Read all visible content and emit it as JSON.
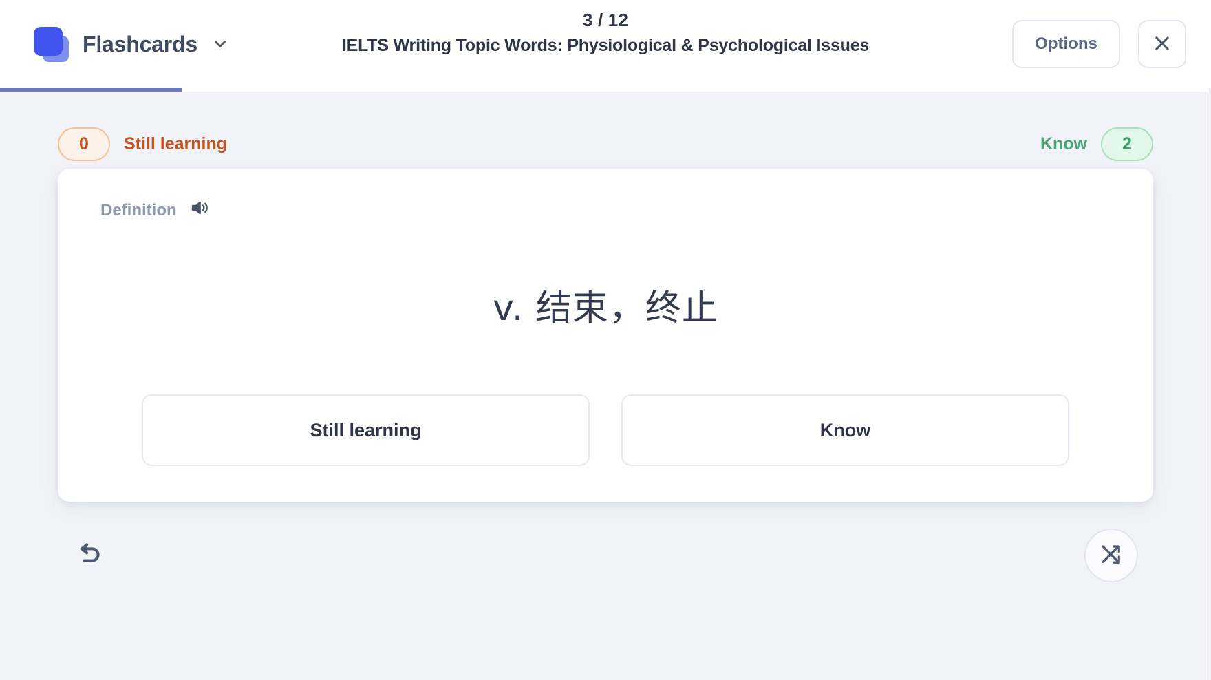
{
  "header": {
    "brand_name": "Flashcards",
    "brand_caret_icon": "chevron-down-icon",
    "logo_icon": "flashcards-logo-icon",
    "progress_count": "3 / 12",
    "deck_title": "IELTS Writing Topic Words: Physiological & Psychological Issues",
    "options_label": "Options",
    "close_icon": "close-icon",
    "progress_percent": 15
  },
  "status": {
    "still_learning_count": "0",
    "still_learning_label": "Still learning",
    "know_label": "Know",
    "know_count": "2"
  },
  "card": {
    "kind_label": "Definition",
    "speaker_icon": "speaker-icon",
    "term": "v. 结束，终止",
    "answers": {
      "still_learning": "Still learning",
      "know": "Know"
    }
  },
  "footer": {
    "undo_icon": "undo-icon",
    "shuffle_icon": "shuffle-icon"
  },
  "colors": {
    "brand_blue": "#4255ef",
    "brand_blue_light": "#7e8ff0",
    "progress_fill": "#6b79c9",
    "still_learning": "#c05621",
    "still_learning_bg": "#fdf2e9",
    "know": "#4aa277",
    "know_bg": "#e3f6ea",
    "page_bg": "#f1f3f8",
    "text_dark": "#2f3546"
  }
}
